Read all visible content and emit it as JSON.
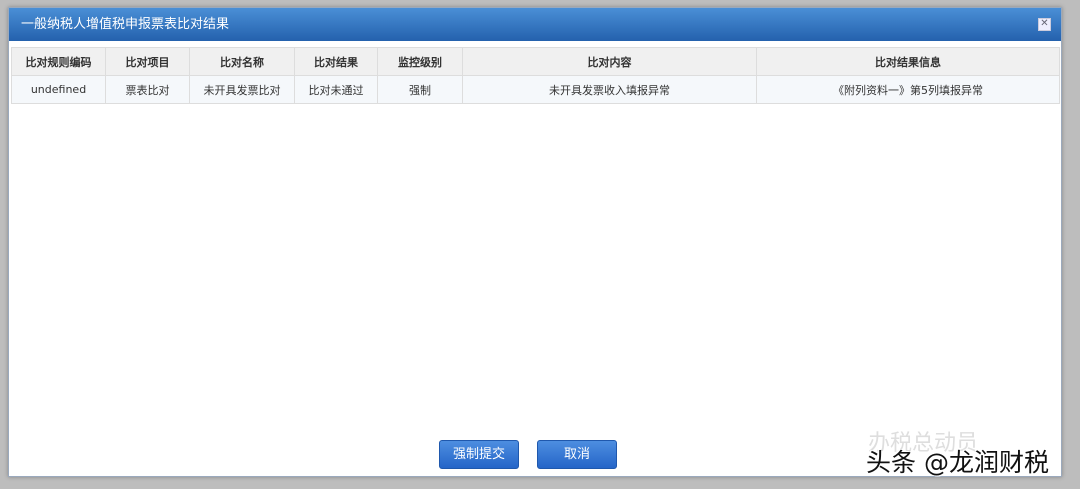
{
  "dialog": {
    "title": "一般纳税人增值税申报票表比对结果"
  },
  "table": {
    "headers": [
      "比对规则编码",
      "比对项目",
      "比对名称",
      "比对结果",
      "监控级别",
      "比对内容",
      "比对结果信息"
    ],
    "rows": [
      [
        "undefined",
        "票表比对",
        "未开具发票比对",
        "比对未通过",
        "强制",
        "未开具发票收入填报异常",
        "《附列资料一》第5列填报异常"
      ]
    ]
  },
  "buttons": {
    "force_submit": "强制提交",
    "cancel": "取消"
  },
  "watermark": {
    "line1": "办税总动员",
    "line2": "头条 @龙润财税"
  }
}
